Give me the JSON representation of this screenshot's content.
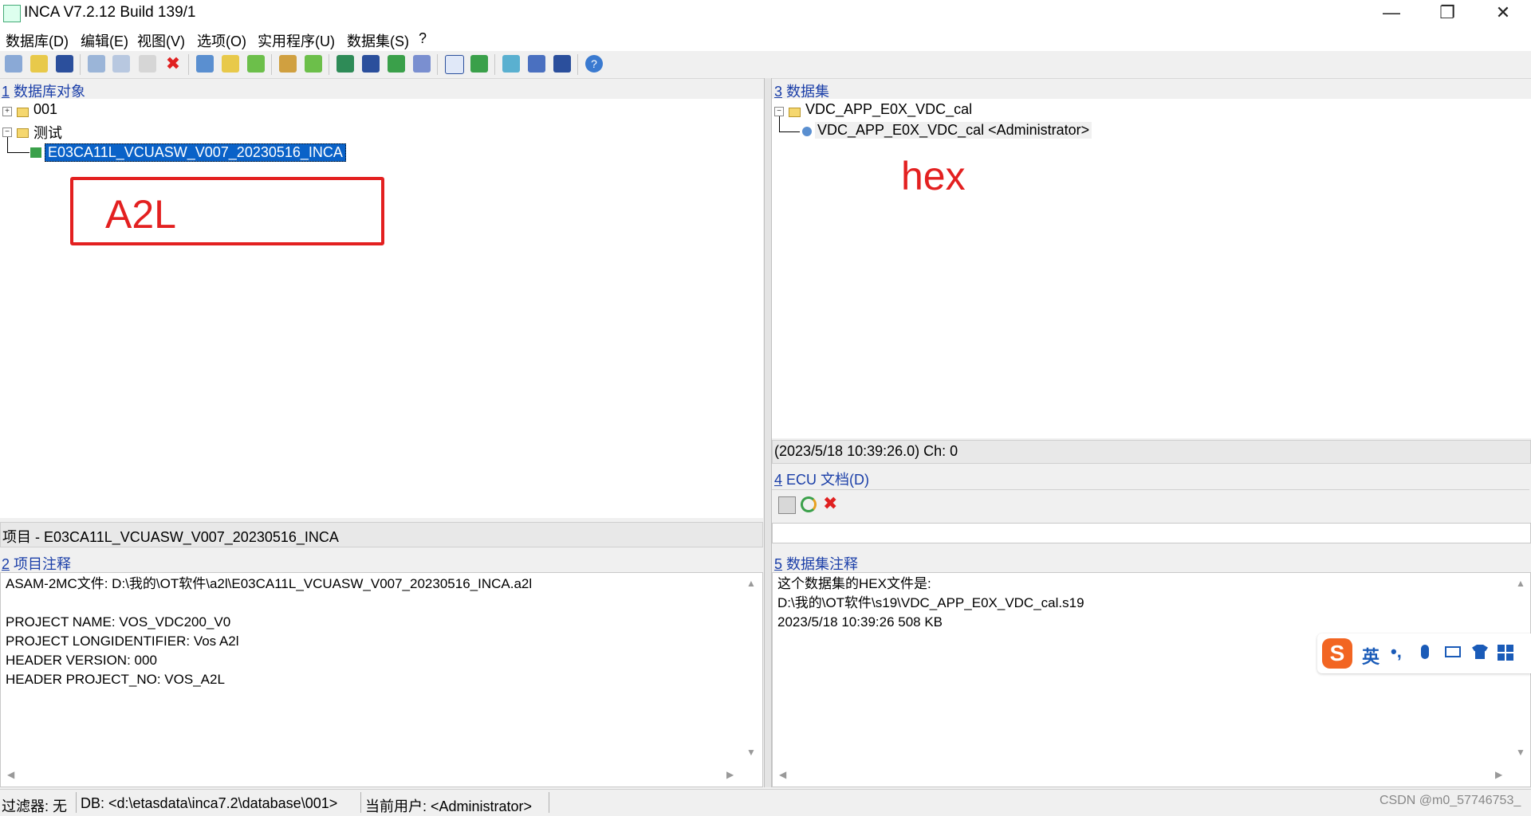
{
  "window": {
    "title": "INCA V7.2.12 Build 139/1",
    "buttons": [
      "minimize",
      "restore",
      "close"
    ]
  },
  "menu": [
    "数据库(D)",
    "编辑(E)",
    "视图(V)",
    "选项(O)",
    "实用程序(U)",
    "数据集(S)",
    "?"
  ],
  "toolbar_icons": [
    "database-icon",
    "open-folder-icon",
    "save-icon",
    "cut-icon",
    "copy-icon",
    "paste-icon",
    "delete-icon",
    "workspace-icon",
    "tree-icon",
    "add-tree-icon",
    "import-icon",
    "export-icon",
    "book-icon",
    "ecu-icon",
    "green-box-icon",
    "compare-icon",
    "checklist-icon",
    "monitor-icon",
    "search-icon",
    "split-icon",
    "settings-icon",
    "help-icon"
  ],
  "panel1": {
    "num": "1",
    "title": "数据库对象",
    "tree": [
      {
        "label": "001",
        "expander": "+"
      },
      {
        "label": "测试",
        "expander": "−"
      },
      {
        "label": "E03CA11L_VCUASW_V007_20230516_INCA",
        "selected": true
      }
    ],
    "status": "项目 - E03CA11L_VCUASW_V007_20230516_INCA"
  },
  "panel2": {
    "num": "2",
    "title": "项目注释",
    "lines": [
      "ASAM-2MC文件: D:\\我的\\OT软件\\a2l\\E03CA11L_VCUASW_V007_20230516_INCA.a2l",
      "",
      "PROJECT NAME: VOS_VDC200_V0",
      "PROJECT LONGIDENTIFIER: Vos A2l",
      "HEADER VERSION: 000",
      "HEADER PROJECT_NO: VOS_A2L"
    ]
  },
  "panel3": {
    "num": "3",
    "title": "数据集",
    "tree": [
      {
        "label": "VDC_APP_E0X_VDC_cal",
        "expander": "−"
      },
      {
        "label": "VDC_APP_E0X_VDC_cal <Administrator>"
      }
    ],
    "status": "(2023/5/18 10:39:26.0) Ch: 0"
  },
  "panel4": {
    "num": "4",
    "title": "ECU 文档(D)",
    "icons": [
      "document-icon",
      "refresh-icon",
      "delete-icon"
    ]
  },
  "panel5": {
    "num": "5",
    "title": "数据集注释",
    "lines": [
      "这个数据集的HEX文件是:",
      "D:\\我的\\OT软件\\s19\\VDC_APP_E0X_VDC_cal.s19",
      "2023/5/18 10:39:26 508 KB"
    ]
  },
  "annotations": {
    "a2l": "A2L",
    "hex": "hex"
  },
  "ime": {
    "mode": "英",
    "punct": "•,"
  },
  "statusbar": {
    "filter": "过滤器: 无",
    "db": "DB: <d:\\etasdata\\inca7.2\\database\\001>",
    "user": "当前用户: <Administrator>"
  },
  "watermark": "CSDN @m0_57746753_"
}
